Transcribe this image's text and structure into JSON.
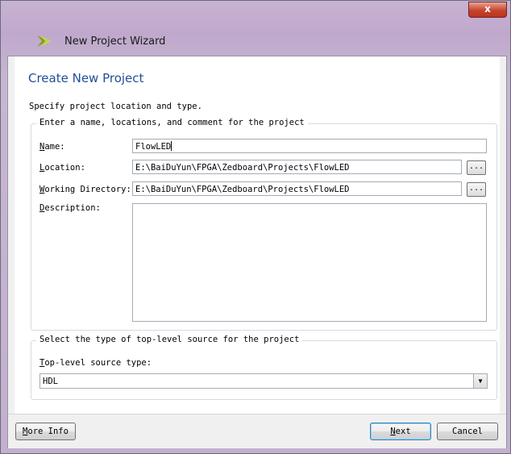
{
  "window": {
    "title": "New Project Wizard",
    "close_label": "x"
  },
  "header": {
    "title": "Create New Project"
  },
  "body": {
    "instruction": "Specify project location and type.",
    "location_group": {
      "legend": "Enter a name, locations, and comment for the project",
      "name_label_key": "N",
      "name_label_rest": "ame:",
      "name_value": "FlowLED",
      "location_label_key": "L",
      "location_label_rest": "ocation:",
      "location_value": "E:\\BaiDuYun\\FPGA\\Zedboard\\Projects\\FlowLED",
      "working_dir_label_key": "W",
      "working_dir_label_rest": "orking Directory:",
      "working_dir_value": "E:\\BaiDuYun\\FPGA\\Zedboard\\Projects\\FlowLED",
      "description_label_key": "D",
      "description_label_rest": "escription:",
      "description_value": "",
      "browse_label": "..."
    },
    "source_group": {
      "legend": "Select the type of top-level source for the project",
      "source_label_key": "T",
      "source_label_rest": "op-level source type:",
      "source_value": "HDL",
      "dropdown_icon": "chevron-down-icon"
    }
  },
  "footer": {
    "more_info_key": "M",
    "more_info_rest": "ore Info",
    "next_key": "N",
    "next_rest": "ext",
    "cancel_label": "Cancel"
  },
  "colors": {
    "header_title": "#1f4f99",
    "title_bar": "#c9b3d4",
    "close_button": "#c7432c"
  }
}
